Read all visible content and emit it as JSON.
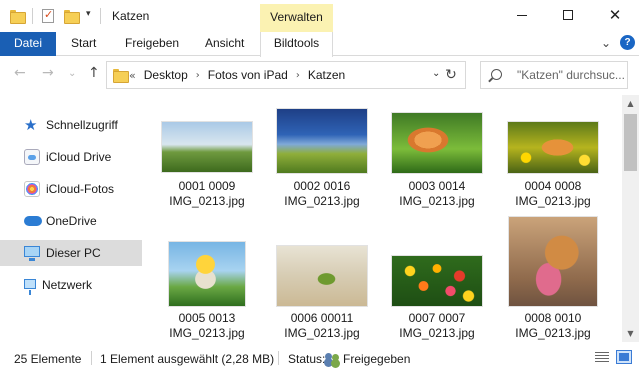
{
  "window": {
    "title": "Katzen",
    "contextual_group": "Verwalten",
    "minimize_symbol": "",
    "close_symbol": "✕"
  },
  "ribbon": {
    "tabs": [
      "Datei",
      "Start",
      "Freigeben",
      "Ansicht",
      "Bildtools"
    ],
    "expand_symbol": "⌄",
    "help_symbol": "?"
  },
  "navigation": {
    "back_symbol": "←",
    "forward_symbol": "→",
    "history_symbol": "⌄",
    "up_symbol": "↑",
    "breadcrumb_overflow": "«",
    "breadcrumb": [
      "Desktop",
      "Fotos von iPad",
      "Katzen"
    ],
    "breadcrumb_separator": "›",
    "refresh_symbol": "↻",
    "search_placeholder": "\"Katzen\" durchsuc..."
  },
  "sidebar": {
    "items": [
      {
        "label": "Schnellzugriff",
        "icon": "star-icon"
      },
      {
        "label": "iCloud Drive",
        "icon": "icloud-drive-icon"
      },
      {
        "label": "iCloud-Fotos",
        "icon": "icloud-photos-icon"
      },
      {
        "label": "OneDrive",
        "icon": "onedrive-cloud-icon"
      },
      {
        "label": "Dieser PC",
        "icon": "this-pc-icon",
        "selected": true
      },
      {
        "label": "Netzwerk",
        "icon": "network-icon"
      }
    ]
  },
  "files": [
    {
      "line1": "0001 0009",
      "line2": "IMG_0213.jpg",
      "subject": "tree on green meadow"
    },
    {
      "line1": "0002 0016",
      "line2": "IMG_0213.jpg",
      "subject": "tree on hill under blue sky"
    },
    {
      "line1": "0003 0014",
      "line2": "IMG_0213.jpg",
      "subject": "ginger cat in grass"
    },
    {
      "line1": "0004 0008",
      "line2": "IMG_0213.jpg",
      "subject": "orange cat among yellow flowers"
    },
    {
      "line1": "0005 0013",
      "line2": "IMG_0213.jpg",
      "subject": "cat with flower crown"
    },
    {
      "line1": "0006 00011",
      "line2": "IMG_0213.jpg",
      "subject": "green leaf on sand"
    },
    {
      "line1": "0007 0007",
      "line2": "IMG_0213.jpg",
      "subject": "colorful tulip field"
    },
    {
      "line1": "0008 0010",
      "line2": "IMG_0213.jpg",
      "subject": "dog holding tulips"
    }
  ],
  "scrollbar": {
    "up_symbol": "▲",
    "down_symbol": "▼"
  },
  "status": {
    "count": "25 Elemente",
    "selection": "1 Element ausgewählt (2,28 MB)",
    "label": "Status:",
    "value": "Freigegeben"
  }
}
